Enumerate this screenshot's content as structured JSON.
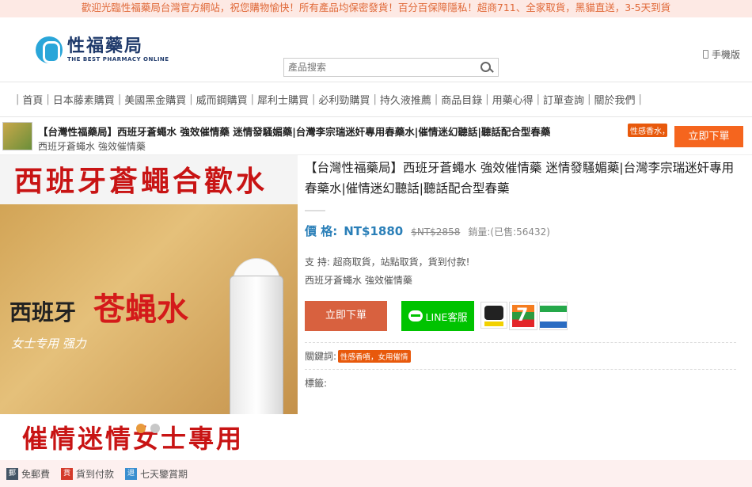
{
  "topbar": {
    "text": "歡迎光臨性福藥局台灣官方網站，祝您購物愉快！所有產品均保密發貨！百分百保障隱私！超商711、全家取貨，黑貓直送，3-5天到貨"
  },
  "header": {
    "logo_title": "性福藥局",
    "logo_sub": "THE BEST PHARMACY ONLINE",
    "search_placeholder": "產品搜索",
    "mobile_label": "手機版"
  },
  "nav": {
    "items": [
      "首頁",
      "日本藤素購買",
      "美國黑金購買",
      "威而鋼購買",
      "犀利士購買",
      "必利勁購買",
      "持久液推薦",
      "商品目錄",
      "用藥心得",
      "訂單查詢",
      "關於我們"
    ]
  },
  "strip": {
    "title": "【台灣性福藥局】西班牙蒼蠅水 強效催情藥 迷情發騷媚藥|台灣李宗瑞迷奸專用春藥水|催情迷幻聽話|聽話配合型春藥",
    "tag": "性感香水，女用催情",
    "subtitle": "西班牙蒼蠅水 強效催情藥",
    "buy_label": "立即下單"
  },
  "image": {
    "top_text": "西班牙蒼蠅合歡水",
    "box_text1": "西班牙",
    "box_text2": "苍蝇水",
    "box_text3": "女士专用 强力",
    "bottom_text": "催情迷情女士專用"
  },
  "product": {
    "title": "【台灣性福藥局】西班牙蒼蠅水 強效催情藥 迷情發騷媚藥|台灣李宗瑞迷奸專用春藥水|催情迷幻聽話|聽話配合型春藥",
    "price_label": "價 格:",
    "price": "NT$1880",
    "old_price": "$NT$2858",
    "sales": "銷量:(已售:56432)",
    "support": "支  持:  超商取貨，站點取貨，貨到付款!",
    "support_desc": "西班牙蒼蠅水 強效催情藥",
    "buy_label": "立即下單",
    "line_label": "LINE客服",
    "keywords_label": "關鍵詞:",
    "keyword_tag": "性感香噴，女用催情",
    "tags_label": "標籤:"
  },
  "badges": [
    {
      "icon": "郵",
      "label": "免郵費",
      "color": "#445566"
    },
    {
      "icon": "貨",
      "label": "貨到付款",
      "color": "#d43a2a"
    },
    {
      "icon": "退",
      "label": "七天鑒賞期",
      "color": "#3a8fd0"
    }
  ]
}
